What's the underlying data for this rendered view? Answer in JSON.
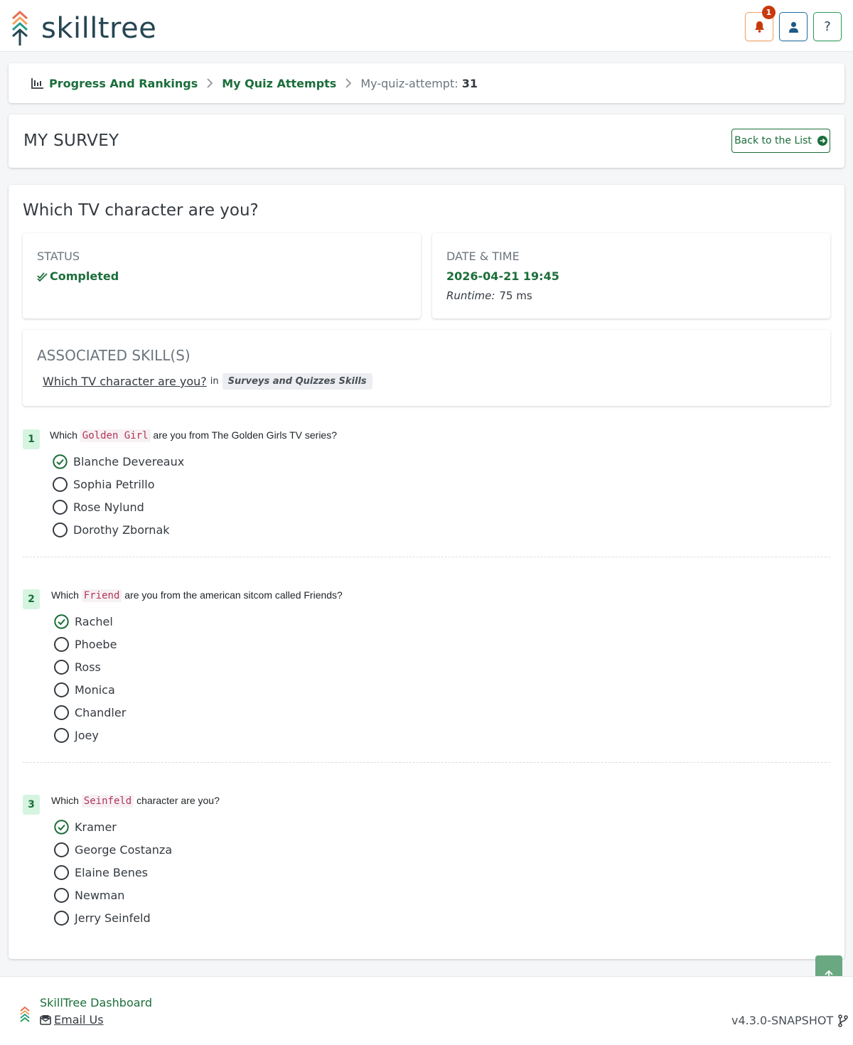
{
  "app": {
    "brand": "skilltree",
    "notification_count": "1",
    "help_label": "?"
  },
  "breadcrumb": {
    "items": [
      "Progress And Rankings",
      "My Quiz Attempts"
    ],
    "current_prefix": "My-quiz-attempt:",
    "current_id": "31"
  },
  "header": {
    "title": "MY SURVEY",
    "back_label": "Back to the List"
  },
  "quiz": {
    "title": "Which TV character are you?",
    "status_label": "STATUS",
    "status_value": "Completed",
    "date_label": "DATE & TIME",
    "date_value": "2026-04-21 19:45",
    "runtime_label": "Runtime:",
    "runtime_value": "75 ms",
    "skills_label": "ASSOCIATED SKILL(S)",
    "skill_name": "Which TV character are you?",
    "skill_in": "in",
    "skill_subject": "Surveys and Quizzes Skills"
  },
  "questions": [
    {
      "num": "1",
      "pre": "Which",
      "code": "Golden Girl",
      "post": "are you from The Golden Girls TV series?",
      "answers": [
        {
          "label": "Blanche Devereaux",
          "selected": true
        },
        {
          "label": "Sophia Petrillo",
          "selected": false
        },
        {
          "label": "Rose Nylund",
          "selected": false
        },
        {
          "label": "Dorothy Zbornak",
          "selected": false
        }
      ]
    },
    {
      "num": "2",
      "pre": "Which",
      "code": "Friend",
      "post": "are you from the american sitcom called Friends?",
      "answers": [
        {
          "label": "Rachel",
          "selected": true
        },
        {
          "label": "Phoebe",
          "selected": false
        },
        {
          "label": "Ross",
          "selected": false
        },
        {
          "label": "Monica",
          "selected": false
        },
        {
          "label": "Chandler",
          "selected": false
        },
        {
          "label": "Joey",
          "selected": false
        }
      ]
    },
    {
      "num": "3",
      "pre": "Which",
      "code": "Seinfeld",
      "post": "character are you?",
      "answers": [
        {
          "label": "Kramer",
          "selected": true
        },
        {
          "label": "George Costanza",
          "selected": false
        },
        {
          "label": "Elaine Benes",
          "selected": false
        },
        {
          "label": "Newman",
          "selected": false
        },
        {
          "label": "Jerry Seinfeld",
          "selected": false
        }
      ]
    }
  ],
  "footer": {
    "title": "SkillTree Dashboard",
    "email": "Email Us",
    "version": "v4.3.0-SNAPSHOT"
  },
  "colors": {
    "accent": "#1b6e3a",
    "brand_text": "#264653",
    "badge": "#c7390c"
  },
  "icons": [
    "bell-icon",
    "user-icon",
    "chart-icon",
    "chevron-right-icon",
    "arrow-circle-right-icon",
    "double-check-icon",
    "check-circle-icon",
    "envelope-icon",
    "code-branch-icon",
    "arrow-up-icon"
  ]
}
